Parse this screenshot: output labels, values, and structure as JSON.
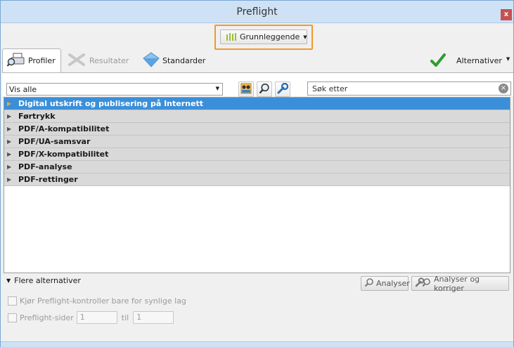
{
  "window": {
    "title": "Preflight",
    "close_label": "x"
  },
  "mode": {
    "label": "Grunnleggende"
  },
  "tabs": [
    {
      "label": "Profiler"
    },
    {
      "label": "Resultater"
    },
    {
      "label": "Standarder"
    }
  ],
  "alternatives": {
    "label": "Alternativer"
  },
  "filter": {
    "value": "Vis alle"
  },
  "search": {
    "placeholder": "Søk etter"
  },
  "profiles": [
    {
      "label": "Digital utskrift og publisering på Internett"
    },
    {
      "label": "Førtrykk"
    },
    {
      "label": "PDF/A-kompatibilitet"
    },
    {
      "label": "PDF/UA-samsvar"
    },
    {
      "label": "PDF/X-kompatibilitet"
    },
    {
      "label": "PDF-analyse"
    },
    {
      "label": "PDF-rettinger"
    }
  ],
  "more_options": {
    "label": "Flere alternativer"
  },
  "buttons": {
    "analyze": "Analyser",
    "analyze_fix": "Analyser og korriger"
  },
  "options": {
    "visible_layers": "Kjør Preflight-kontroller bare for synlige lag",
    "pages": "Preflight-sider",
    "page_from": "1",
    "to_label": "til",
    "page_to": "1"
  },
  "colors": {
    "accent": "#3b8fd9",
    "highlight_border": "#f09a2a",
    "check": "#2e9b2e"
  }
}
